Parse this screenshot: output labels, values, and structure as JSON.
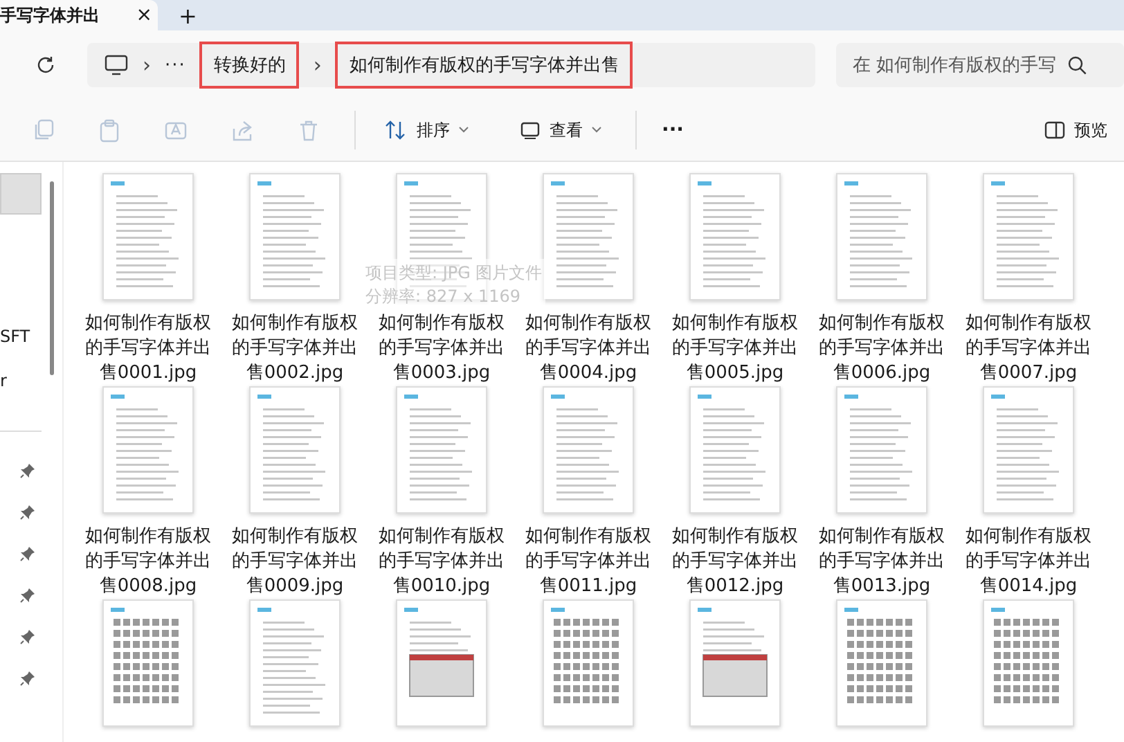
{
  "tab": {
    "title": "手写字体并出",
    "close": "×"
  },
  "new_tab": "+",
  "nav": {
    "more": "···",
    "separators": [
      "›",
      "›"
    ],
    "breadcrumbs": [
      {
        "label": "转换好的",
        "highlighted": true
      },
      {
        "label": "如何制作有版权的手写字体并出售",
        "highlighted": true
      }
    ],
    "search": {
      "placeholder": "在 如何制作有版权的手写"
    }
  },
  "toolbar": {
    "actions": [
      {
        "kind": "copy",
        "disabled": true
      },
      {
        "kind": "paste",
        "disabled": true
      },
      {
        "kind": "rename",
        "disabled": true
      },
      {
        "kind": "share",
        "disabled": true
      },
      {
        "kind": "delete",
        "disabled": true
      }
    ],
    "sort": "排序",
    "view": "查看",
    "more": "···",
    "preview": "预览"
  },
  "sidebar": {
    "highlight": true,
    "items": [
      {
        "label": "SFT",
        "selected": false
      },
      {
        "label": "r",
        "selected": false
      }
    ]
  },
  "files": [
    {
      "label": "如何制作有版权的手写字体并出售0001.jpg"
    },
    {
      "label": "如何制作有版权的手写字体并出售0002.jpg"
    },
    {
      "label": "如何制作有版权的手写字体并出售0003.jpg"
    },
    {
      "label": "如何制作有版权的手写字体并出售0004.jpg"
    },
    {
      "label": "如何制作有版权的手写字体并出售0005.jpg"
    },
    {
      "label": "如何制作有版权的手写字体并出售0006.jpg"
    },
    {
      "label": "如何制作有版权的手写字体并出售0007.jpg"
    },
    {
      "label": "如何制作有版权的手写字体并出售0008.jpg"
    },
    {
      "label": "如何制作有版权的手写字体并出售0009.jpg"
    },
    {
      "label": "如何制作有版权的手写字体并出售0010.jpg"
    },
    {
      "label": "如何制作有版权的手写字体并出售0011.jpg"
    },
    {
      "label": "如何制作有版权的手写字体并出售0012.jpg"
    },
    {
      "label": "如何制作有版权的手写字体并出售0013.jpg"
    },
    {
      "label": "如何制作有版权的手写字体并出售0014.jpg"
    },
    {
      "kind": "character-grid"
    },
    {
      "kind": "document"
    },
    {
      "kind": "screenshot"
    },
    {
      "kind": "character-grid"
    },
    {
      "kind": "screenshot"
    },
    {
      "kind": "character-grid"
    },
    {
      "kind": "character-grid"
    }
  ],
  "tooltip": {
    "lines": [
      "项目类型: JPG 图片文件",
      "分辨率: 827 x 1169"
    ]
  }
}
